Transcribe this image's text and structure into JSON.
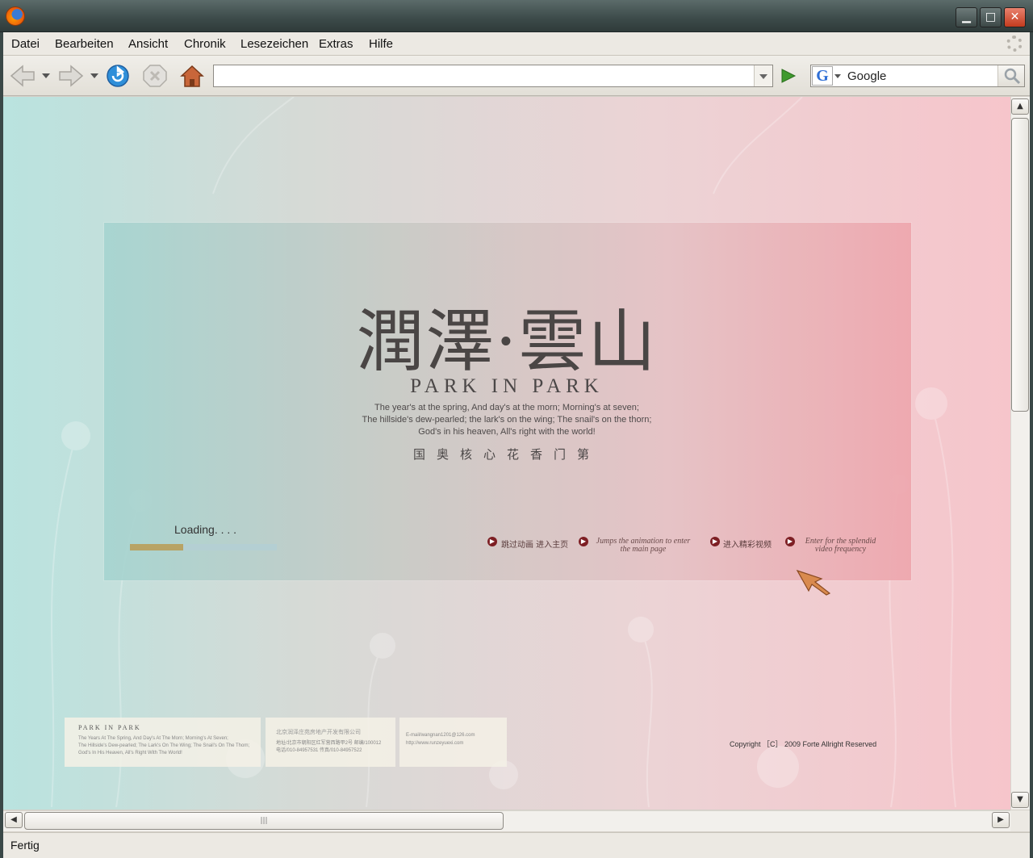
{
  "window": {
    "minimize": "▁",
    "maximize": "□",
    "close": "✕"
  },
  "menu": [
    "Datei",
    "Bearbeiten",
    "Ansicht",
    "Chronik",
    "Lesezeichen",
    "Extras",
    "Hilfe"
  ],
  "toolbar": {
    "url_value": "",
    "search_engine_letter": "G",
    "search_value": "Google"
  },
  "page": {
    "cn_title": "潤澤·雲山",
    "en_title": "PARK IN PARK",
    "poem": [
      "The year's at the spring, And day's at the morn; Morning's at seven;",
      "The hillside's dew-pearled; the lark's on the wing; The snail's on the thorn;",
      "God's in his heaven, All's right with the world!"
    ],
    "cn_subtitle": "国奥核心花香门第",
    "loading_text": "Loading. . . .",
    "loading_progress": 0.36,
    "links": {
      "skip_cn": "跳过动画 进入主页",
      "skip_en_1": "Jumps the animation to enter",
      "skip_en_2": "the main page",
      "video_cn": "进入精彩视频",
      "video_en_1": "Enter for the splendid",
      "video_en_2": "video frequency"
    },
    "footer": {
      "box1_title": "PARK IN PARK",
      "box1_lines": [
        "The Years At The Spring, And Day's At The Morn; Morning's At Seven;",
        "The Hillside's Dew-pearled; The Lark's On The Wing; The Snail's On The Thorn;",
        "God's In His Heaven, All's Right With The World!"
      ],
      "box2_title": "北京润泽庄苑房地产开发有限公司",
      "box2_lines": [
        "地址/北京市朝阳区红军营西路甲2号  邮编/100012",
        "电话/010-84957531  传真/010-84957522"
      ],
      "box3_lines": [
        "E-mail/wangnan1201@126.com",
        "http://www.runzeyuexi.com"
      ]
    },
    "copyright": "Copyright  ［C］ 2009 Forte Allright Reserved"
  },
  "scrollbar": {
    "grip": "|||"
  },
  "status": "Fertig"
}
